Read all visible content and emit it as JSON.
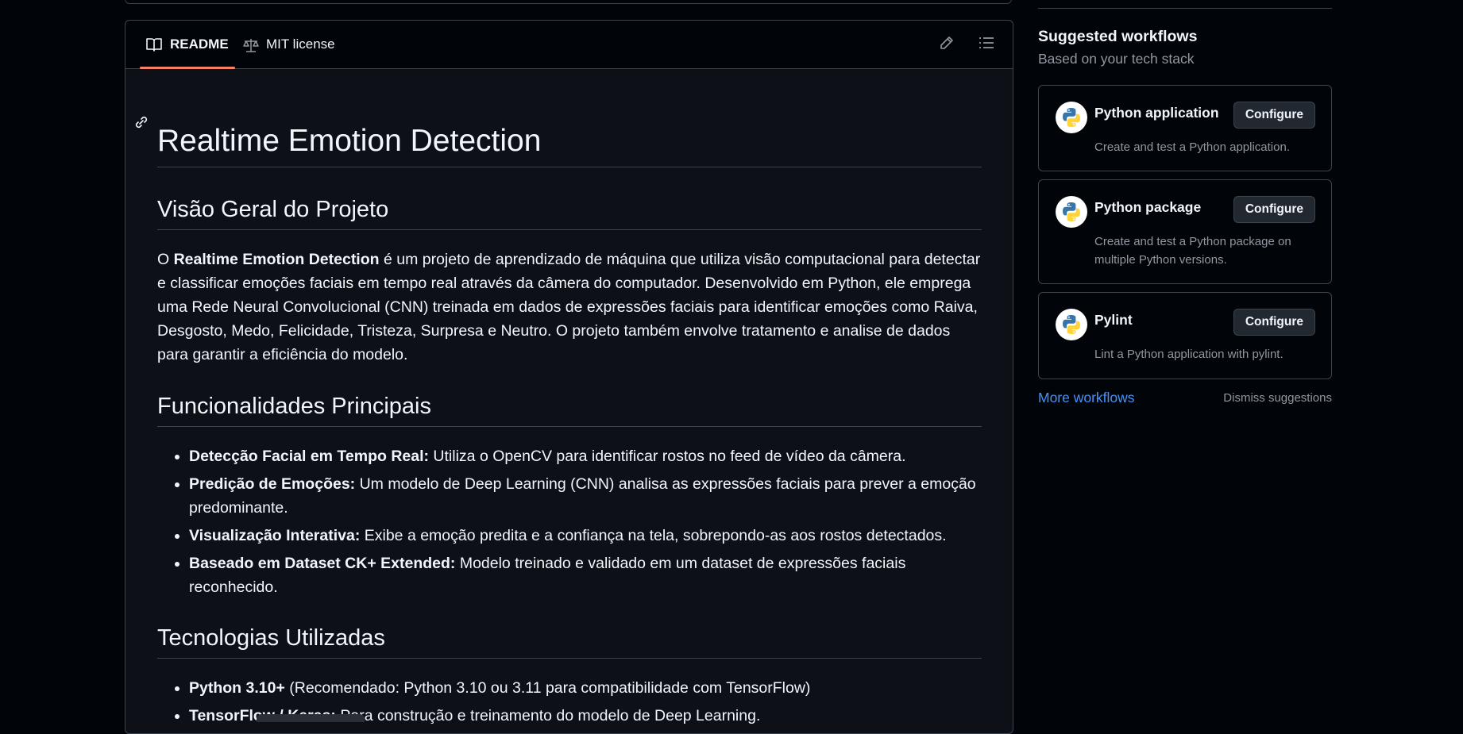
{
  "readme_tabs": [
    {
      "label": "README",
      "icon": "book-icon"
    },
    {
      "label": "MIT license",
      "icon": "scale-icon"
    }
  ],
  "header_actions": {
    "edit_icon": "pencil-icon",
    "toc_icon": "list-icon"
  },
  "readme": {
    "title": "Realtime Emotion Detection",
    "section_overview": {
      "heading": "Visão Geral do Projeto",
      "lead_prefix": "O ",
      "lead_bold": "Realtime Emotion Detection",
      "lead_rest": " é um projeto de aprendizado de máquina que utiliza visão computacional para detectar e classificar emoções faciais em tempo real através da câmera do computador. Desenvolvido em Python, ele emprega uma Rede Neural Convolucional (CNN) treinada em dados de expressões faciais para identificar emoções como Raiva, Desgosto, Medo, Felicidade, Tristeza, Surpresa e Neutro. O projeto também envolve tratamento e analise de dados para garantir a eficiência do modelo."
    },
    "section_features": {
      "heading": "Funcionalidades Principais",
      "items": [
        {
          "bold": "Detecção Facial em Tempo Real:",
          "text": " Utiliza o OpenCV para identificar rostos no feed de vídeo da câmera."
        },
        {
          "bold": "Predição de Emoções:",
          "text": " Um modelo de Deep Learning (CNN) analisa as expressões faciais para prever a emoção predominante."
        },
        {
          "bold": "Visualização Interativa:",
          "text": " Exibe a emoção predita e a confiança na tela, sobrepondo-as aos rostos detectados."
        },
        {
          "bold": "Baseado em Dataset CK+ Extended:",
          "text": " Modelo treinado e validado em um dataset de expressões faciais reconhecido."
        }
      ]
    },
    "section_tech": {
      "heading": "Tecnologias Utilizadas",
      "items": [
        {
          "bold": "Python 3.10+",
          "text": " (Recomendado: Python 3.10 ou 3.11 para compatibilidade com TensorFlow)"
        },
        {
          "bold": "TensorFlow / Keras:",
          "text": " Para construção e treinamento do modelo de Deep Learning."
        }
      ]
    }
  },
  "sidebar": {
    "title": "Suggested workflows",
    "subtitle": "Based on your tech stack",
    "workflows": [
      {
        "name": "Python application",
        "description": "Create and test a Python application.",
        "button": "Configure",
        "icon": "python-icon"
      },
      {
        "name": "Python package",
        "description": "Create and test a Python package on multiple Python versions.",
        "button": "Configure",
        "icon": "python-icon"
      },
      {
        "name": "Pylint",
        "description": "Lint a Python application with pylint.",
        "button": "Configure",
        "icon": "python-icon"
      }
    ],
    "more_link": "More workflows",
    "dismiss_link": "Dismiss suggestions"
  },
  "colors": {
    "accent": "#f78166",
    "link": "#4493f8",
    "background": "#010409",
    "border": "#3d444d"
  }
}
